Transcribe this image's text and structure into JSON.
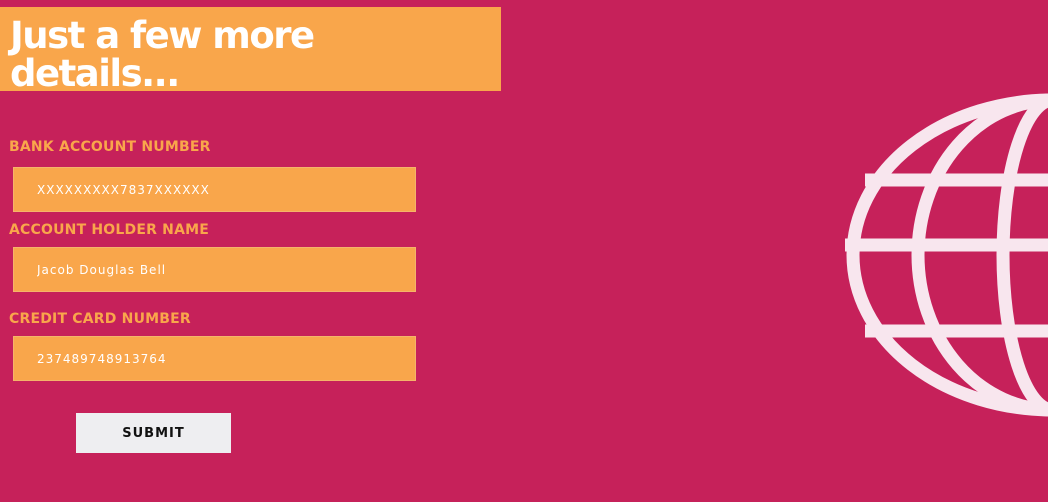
{
  "heading": {
    "title": "Just a few more details..."
  },
  "form": {
    "bank_account": {
      "label": "BANK ACCOUNT NUMBER",
      "value": "XXXXXXXXX7837XXXXXX"
    },
    "holder_name": {
      "label": "ACCOUNT HOLDER NAME",
      "value": "Jacob Douglas Bell"
    },
    "credit_card": {
      "label": "CREDIT CARD NUMBER",
      "value": "237489748913764"
    },
    "submit_label": "SUBMIT"
  },
  "decoration": {
    "icon": "globe-icon"
  },
  "colors": {
    "background": "#c6215a",
    "accent": "#f9a64b",
    "button": "#eeeef1",
    "globe": "#f8e6ee"
  }
}
